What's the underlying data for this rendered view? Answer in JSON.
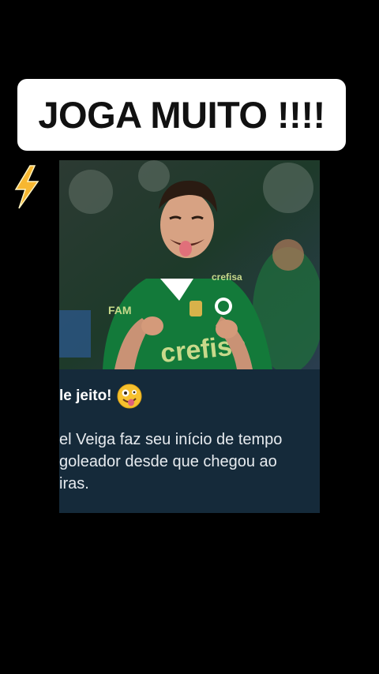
{
  "caption": {
    "text": "JOGA MUITO !!!!"
  },
  "decoration": {
    "bolt_icon": "lightning-bolt-icon",
    "bolt_color": "#f7b731"
  },
  "post": {
    "headline": "le jeito!",
    "headline_emoji": "zany-face-icon",
    "body_lines": [
      "el Veiga faz seu início de tempo",
      "goleador desde que chegou ao",
      "iras."
    ],
    "jersey": {
      "sponsor": "crefisa",
      "chest_brand": "crefisa",
      "sleeve_brand": "FAM",
      "sleeve_text": "crefisa",
      "color": "#137a3a"
    },
    "card_bg": "#152a3a"
  }
}
